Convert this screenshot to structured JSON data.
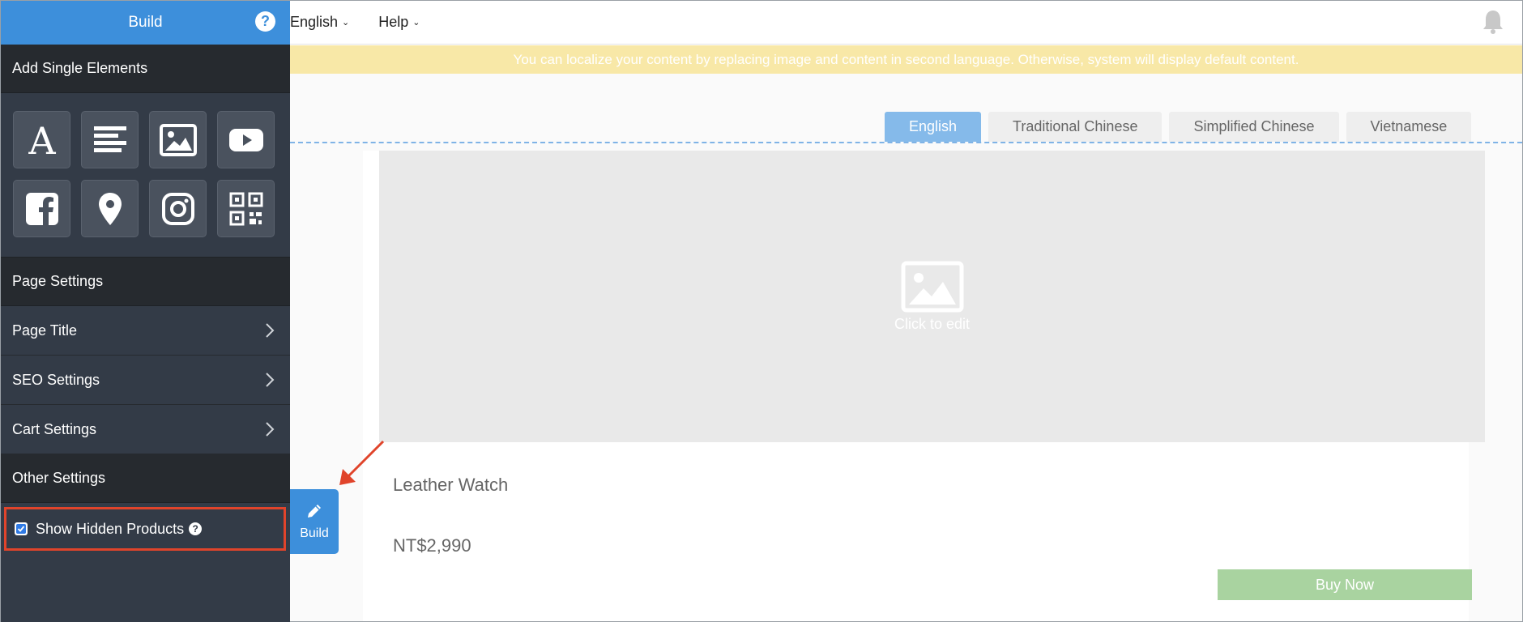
{
  "sidebar": {
    "header": "Build",
    "add_section": "Add Single Elements",
    "tiles": [
      "text-icon",
      "paragraph-icon",
      "image-icon",
      "youtube-icon",
      "facebook-icon",
      "map-pin-icon",
      "instagram-icon",
      "qr-code-icon"
    ],
    "page_settings": "Page Settings",
    "items": [
      {
        "label": "Page Title"
      },
      {
        "label": "SEO Settings"
      },
      {
        "label": "Cart Settings"
      }
    ],
    "other_settings": "Other Settings",
    "show_hidden_label": "Show Hidden Products",
    "show_hidden_checked": true
  },
  "topbar": {
    "language_menu": "English",
    "help_menu": "Help"
  },
  "notice": "You can localize your content by replacing image and content in second language. Otherwise, system will display default content.",
  "tabs": [
    {
      "label": "English",
      "active": true
    },
    {
      "label": "Traditional Chinese",
      "active": false
    },
    {
      "label": "Simplified Chinese",
      "active": false
    },
    {
      "label": "Vietnamese",
      "active": false
    }
  ],
  "product": {
    "click_to_edit": "Click to edit",
    "title": "Leather Watch",
    "price": "NT$2,990",
    "buy_label": "Buy Now"
  },
  "build_button": "Build",
  "colors": {
    "accent": "#3d8fdb",
    "sidebar_bg": "#333b47",
    "highlight": "#e0442b",
    "notice_bg": "#f8e8a7",
    "buy_bg": "#a9d3a0"
  }
}
